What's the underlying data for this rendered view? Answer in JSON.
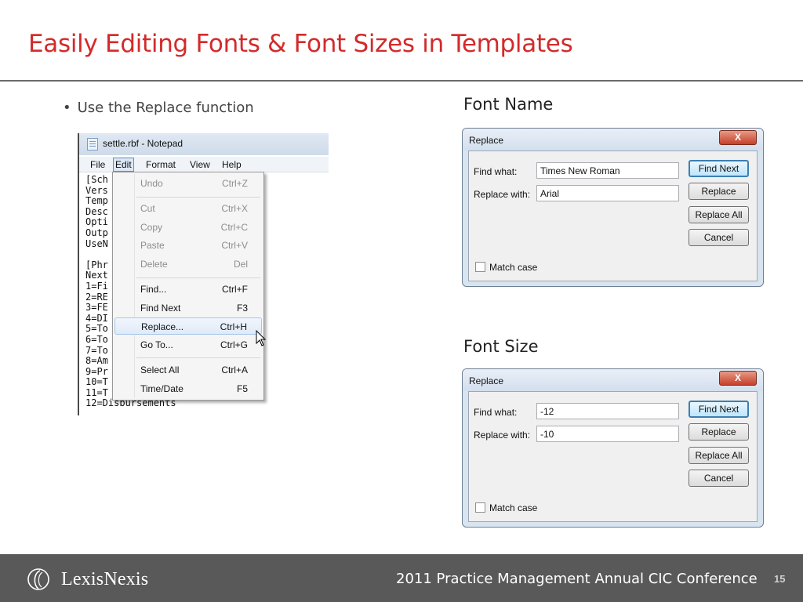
{
  "slide": {
    "title": "Easily Editing Fonts & Font Sizes in Templates",
    "bullet": "Use the Replace function",
    "bullet_marker": "•"
  },
  "notepad": {
    "title": "settle.rbf - Notepad",
    "menubar": [
      "File",
      "Edit",
      "Format",
      "View",
      "Help"
    ],
    "active_menu": "Edit",
    "text_lines": [
      "[Sch",
      "Vers",
      "Temp",
      "Desc                ment State",
      "Opti                /16|Snap|1",
      "Outp",
      "UseN                SE",
      "",
      "[Phr",
      "Next",
      "1=Fi",
      "2=RE",
      "3=FE",
      "4=DI",
      "5=To",
      "6=To",
      "7=To                ents",
      "8=Am",
      "9=Pr",
      "10=T",
      "11=T",
      "12=Disbursements"
    ]
  },
  "edit_menu": {
    "items": [
      {
        "label": "Undo",
        "shortcut": "Ctrl+Z",
        "disabled": true
      },
      {
        "label": "Cut",
        "shortcut": "Ctrl+X",
        "disabled": true
      },
      {
        "label": "Copy",
        "shortcut": "Ctrl+C",
        "disabled": true
      },
      {
        "label": "Paste",
        "shortcut": "Ctrl+V",
        "disabled": true
      },
      {
        "label": "Delete",
        "shortcut": "Del",
        "disabled": true
      },
      {
        "label": "Find...",
        "shortcut": "Ctrl+F",
        "disabled": false
      },
      {
        "label": "Find Next",
        "shortcut": "F3",
        "disabled": false
      },
      {
        "label": "Replace...",
        "shortcut": "Ctrl+H",
        "disabled": false,
        "hovered": true
      },
      {
        "label": "Go To...",
        "shortcut": "Ctrl+G",
        "disabled": false
      },
      {
        "label": "Select All",
        "shortcut": "Ctrl+A",
        "disabled": false
      },
      {
        "label": "Time/Date",
        "shortcut": "F5",
        "disabled": false
      }
    ]
  },
  "font_name_section": {
    "heading": "Font Name",
    "dialog": {
      "title": "Replace",
      "close_label": "X",
      "find_label": "Find what:",
      "find_value": "Times New Roman",
      "replace_label": "Replace with:",
      "replace_value": "Arial",
      "find_next_button": "Find Next",
      "replace_button": "Replace",
      "replace_all_button": "Replace All",
      "cancel_button": "Cancel",
      "match_case_label": "Match case",
      "match_case_checked": false
    }
  },
  "font_size_section": {
    "heading": "Font Size",
    "dialog": {
      "title": "Replace",
      "close_label": "X",
      "find_label": "Find what:",
      "find_value": "-12",
      "replace_label": "Replace with:",
      "replace_value": "-10",
      "find_next_button": "Find Next",
      "replace_button": "Replace",
      "replace_all_button": "Replace All",
      "cancel_button": "Cancel",
      "match_case_label": "Match case",
      "match_case_checked": false
    }
  },
  "footer": {
    "logo_text": "LexisNexis",
    "conference": "2011 Practice Management Annual CIC Conference",
    "page_number": "15"
  },
  "colors": {
    "title_red": "#d42a2a",
    "footer_bg": "#595959",
    "dialog_frame": "#d9e4f1"
  }
}
